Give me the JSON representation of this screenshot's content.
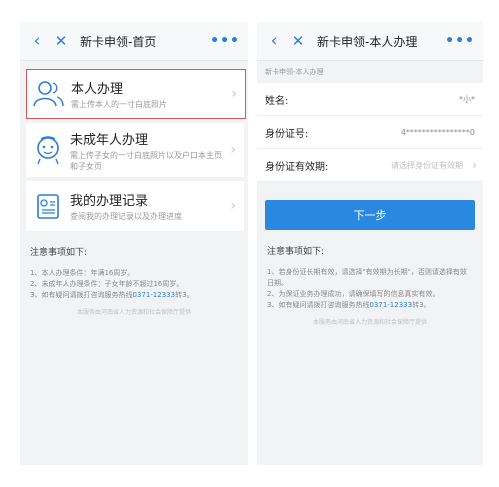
{
  "left": {
    "title": "新卡申领-首页",
    "more": "•••",
    "cards": [
      {
        "title": "本人办理",
        "desc": "需上传本人的一寸白底照片"
      },
      {
        "title": "未成年人办理",
        "desc": "需上传子女的一寸白底照片以及户口本主页和子女页"
      },
      {
        "title": "我的办理记录",
        "desc": "查阅我的办理记录以及办理进度"
      }
    ],
    "notes_title": "注意事项如下:",
    "notes": [
      "1、本人办理条件：年满16周岁。",
      "2、未成年人办理条件：子女年龄不超过16周岁。"
    ],
    "note3_prefix": "3、如有疑问请拨打咨询服务热线",
    "hotline": "0371-12333",
    "note3_suffix": "转3。",
    "footer": "本服务由河南省人力资源和社会保障厅提供"
  },
  "right": {
    "title": "新卡申领-本人办理",
    "more": "•••",
    "breadcrumb": "新卡申领-本人办理",
    "fields": {
      "name_label": "姓名:",
      "name_value": "*小*",
      "id_label": "身份证号:",
      "id_value": "4****************0",
      "validity_label": "身份证有效期:",
      "validity_placeholder": "请选择身份证有效期"
    },
    "next_label": "下一步",
    "notes_title": "注意事项如下:",
    "notes": [
      "1、若身份证长期有效，请选择\"有效期为长期\"，否则请选择有效日期。",
      "2、为保证业务办理成功，请确保填写的信息真实有效。"
    ],
    "note3_prefix": "3、如有疑问请拨打咨询服务热线",
    "hotline": "0371-12333",
    "note3_suffix": "转3。",
    "footer": "本服务由河南省人力资源和社会保障厅提供"
  },
  "colors": {
    "accent": "#2b7fd8",
    "button": "#2b88e0",
    "highlight_border": "#e05555"
  },
  "icons": {
    "back": "chevron-left-icon",
    "close": "close-icon",
    "person": "person-icon",
    "child": "child-icon",
    "record": "record-icon"
  }
}
